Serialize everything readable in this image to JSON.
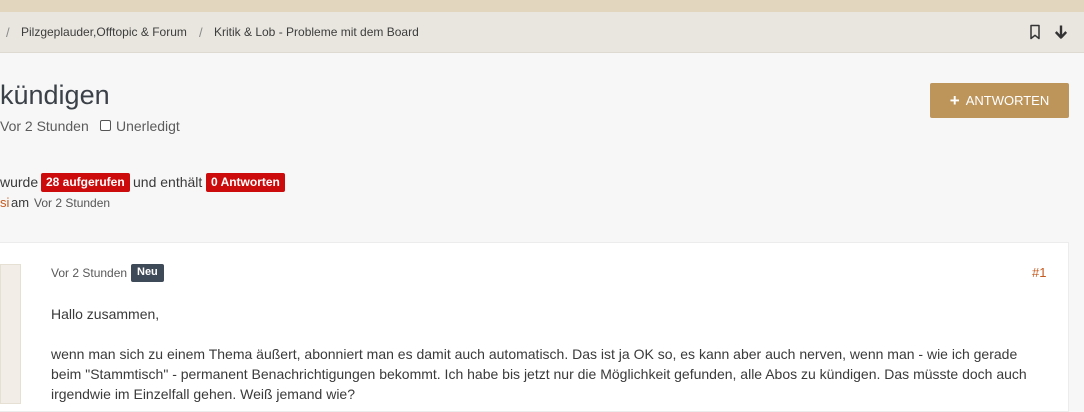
{
  "breadcrumb": {
    "items": [
      "Pilzgeplauder,Offtopic & Forum",
      "Kritik & Lob - Probleme mit dem Board"
    ],
    "separator": "/"
  },
  "thread": {
    "title": "kündigen",
    "created": "Vor 2 Stunden",
    "status_label": "Unerledigt",
    "reply_button": "ANTWORTEN",
    "stats_prefix": "wurde",
    "views_badge": "28 aufgerufen",
    "stats_middle": "und enthält",
    "replies_badge": "0 Antworten",
    "author_partial": "si",
    "author_am": "am",
    "author_time": "Vor 2 Stunden"
  },
  "post": {
    "time": "Vor 2 Stunden",
    "new_badge": "Neu",
    "number": "#1",
    "paragraphs": [
      "Hallo zusammen,",
      "wenn man sich zu einem Thema äußert, abonniert man es damit auch automatisch. Das ist ja OK so, es kann aber auch nerven, wenn man - wie ich gerade beim \"Stammtisch\" - permanent Benachrichtigungen bekommt. Ich habe bis jetzt nur die Möglichkeit gefunden, alle Abos zu kündigen. Das müsste doch auch irgendwie im Einzelfall gehen. Weiß jemand wie?"
    ]
  },
  "icons": [
    "bookmark-icon",
    "arrow-down-icon",
    "plus-icon",
    "checkbox-icon"
  ],
  "colors": {
    "accent": "#bd955b",
    "badge_red": "#cc0c0c",
    "badge_dark": "#3f4a58",
    "link_orange": "#c55a1e",
    "top_strip": "#e3d6be",
    "breadcrumb_bar": "#e9e6df"
  }
}
